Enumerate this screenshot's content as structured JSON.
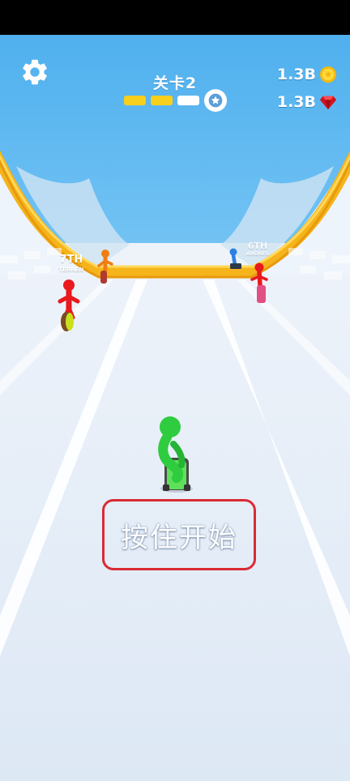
{
  "hud": {
    "level_label": "关卡2",
    "coins": "1.3B",
    "gems": "1.3B",
    "progress": {
      "completed_stages": 2,
      "total_stages": 3
    }
  },
  "racers": [
    {
      "rank_label": "7TH",
      "name": "TERREN"
    },
    {
      "rank_label": "6TH",
      "name": "ANDRES"
    }
  ],
  "start_prompt": "按住开始",
  "colors": {
    "sky": "#5ab4ee",
    "track_rail": "#f6b41c",
    "progress_done": "#f7cf1d",
    "progress_pending": "#ffffff",
    "player": "#2ecc3e",
    "opponent_red": "#e8191f",
    "opponent_orange": "#f07d12",
    "opponent_blue": "#2d7fe3",
    "prompt_border": "#d92b34"
  },
  "icons": [
    "gear-icon",
    "star-icon",
    "coin-icon",
    "gem-icon"
  ]
}
